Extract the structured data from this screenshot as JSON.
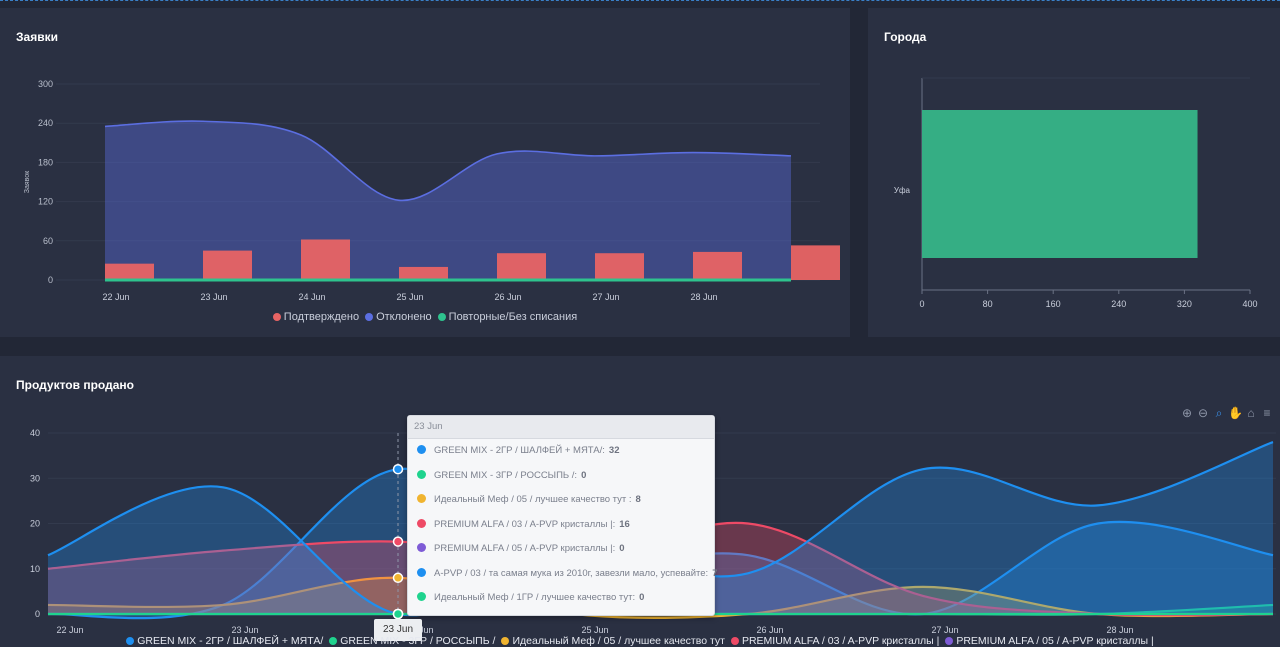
{
  "panels": {
    "orders": {
      "title": "Заявки"
    },
    "cities": {
      "title": "Города"
    },
    "products": {
      "title": "Продуктов продано"
    }
  },
  "chart_data": [
    {
      "type": "bar",
      "title": "Заявки",
      "ylabel": "Заявок",
      "categories": [
        "22 Jun",
        "23 Jun",
        "24 Jun",
        "25 Jun",
        "26 Jun",
        "27 Jun",
        "28 Jun"
      ],
      "ylim": [
        0,
        300
      ],
      "yticks": [
        0,
        60,
        120,
        180,
        240,
        300
      ],
      "series": [
        {
          "name": "Подтверждено",
          "kind": "bar",
          "color": "#e86464",
          "values": [
            25,
            45,
            62,
            20,
            41,
            41,
            43,
            53
          ]
        },
        {
          "name": "Отклонено",
          "kind": "area",
          "color": "#5b6ee1",
          "values": [
            235,
            243,
            222,
            122,
            193,
            190,
            195,
            190
          ]
        },
        {
          "name": "Повторные/Без списания",
          "kind": "line",
          "color": "#2ec38e",
          "values": [
            0,
            0,
            0,
            0,
            0,
            0,
            0,
            0
          ]
        }
      ],
      "legend_position": "bottom"
    },
    {
      "type": "bar",
      "title": "Города",
      "orientation": "horizontal",
      "categories": [
        "Уфа"
      ],
      "values": [
        336
      ],
      "color": "#35ae84",
      "xlim": [
        0,
        400
      ],
      "xticks": [
        0,
        80,
        160,
        240,
        320,
        400
      ]
    },
    {
      "type": "area",
      "title": "Продуктов продано",
      "x_labels": [
        "22 Jun",
        "23 Jun",
        "24 Jun",
        "25 Jun",
        "26 Jun",
        "27 Jun",
        "28 Jun"
      ],
      "ylim": [
        0,
        40
      ],
      "yticks": [
        0,
        10,
        20,
        30,
        40
      ],
      "series": [
        {
          "name": "GREEN MIX - 2ГР / ШАЛФЕЙ + МЯТА/",
          "color": "#1e8ff0",
          "values": [
            0,
            2,
            32,
            12,
            13,
            0,
            20,
            13
          ]
        },
        {
          "name": "GREEN MIX - 3ГР / РОССЫПЬ /",
          "color": "#1fd38e",
          "values": [
            0,
            0,
            0,
            0,
            0,
            0,
            0,
            2
          ]
        },
        {
          "name": "Идеальный Меф / 05 / лучшее качество тут",
          "color": "#f0b430",
          "values": [
            2,
            2,
            8,
            0,
            0,
            6,
            0,
            0
          ]
        },
        {
          "name": "PREMIUM ALFA / 03 / A-PVP кристаллы |",
          "color": "#ee4a66",
          "values": [
            10,
            14,
            16,
            12,
            20,
            4,
            0,
            0
          ]
        },
        {
          "name": "PREMIUM ALFA / 05 / A-PVP кристаллы |",
          "color": "#7e5bd6",
          "values": [
            0,
            0,
            0,
            0,
            0,
            0,
            0,
            0
          ]
        },
        {
          "name": "A-PVP / 03 / та самая мука из 2010г, завезли мало, успевайте",
          "color": "#1e8ff0",
          "values": [
            13,
            28,
            0,
            13,
            9,
            32,
            24,
            38
          ]
        },
        {
          "name": "Идеальный Меф / 1ГР / лучшее качество тут",
          "color": "#1fd38e",
          "values": [
            0,
            0,
            0,
            0,
            0,
            0,
            0,
            0
          ]
        }
      ],
      "tooltip": {
        "header": "23 Jun",
        "x_marker": "23 Jun",
        "rows": [
          {
            "label": "GREEN MIX - 2ГР / ШАЛФЕЙ + МЯТА/:",
            "value": "32",
            "color": "#1e8ff0"
          },
          {
            "label": "GREEN MIX - 3ГР / РОССЫПЬ /:",
            "value": "0",
            "color": "#1fd38e"
          },
          {
            "label": "Идеальный Меф / 05 / лучшее качество тут :",
            "value": "8",
            "color": "#f0b430"
          },
          {
            "label": "PREMIUM ALFA / 03 / A-PVP кристаллы |:",
            "value": "16",
            "color": "#ee4a66"
          },
          {
            "label": "PREMIUM ALFA / 05 / A-PVP кристаллы |:",
            "value": "0",
            "color": "#7e5bd6"
          },
          {
            "label": "A-PVP / 03 / та самая мука из 2010г, завезли мало, успевайте:",
            "value": "7",
            "color": "#1e8ff0"
          },
          {
            "label": "Идеальный Меф / 1ГР / лучшее качество тут:",
            "value": "0",
            "color": "#1fd38e"
          }
        ]
      },
      "legend": [
        {
          "label": "GREEN MIX - 2ГР / ШАЛФЕЙ + МЯТА/",
          "color": "#1e8ff0"
        },
        {
          "label": "GREEN MIX - 3ГР / РОССЫПЬ /",
          "color": "#1fd38e"
        },
        {
          "label": "Идеальный Меф / 05 / лучшее качество тут",
          "color": "#f0b430"
        },
        {
          "label": "PREMIUM ALFA / 03 / A-PVP кристаллы |",
          "color": "#ee4a66"
        },
        {
          "label": "PREMIUM ALFA / 05 / A-PVP кристаллы |",
          "color": "#7e5bd6"
        }
      ],
      "toolbar_icons": [
        "zoom-in-icon",
        "zoom-out-icon",
        "selection-zoom-icon",
        "pan-icon",
        "reset-home-icon",
        "menu-icon"
      ]
    }
  ]
}
